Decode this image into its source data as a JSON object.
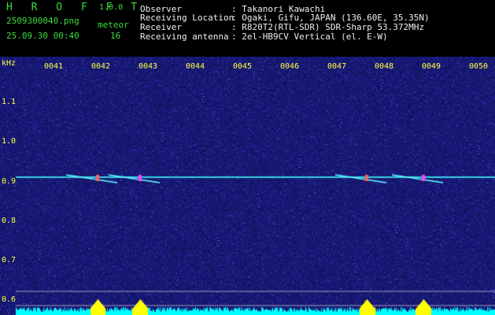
{
  "app": {
    "name": "H R O F F T",
    "version": "1.0.0"
  },
  "file": {
    "name": "2509300040.png",
    "datetime": "25.09.30 00:40"
  },
  "meteor": {
    "label": "meteor",
    "count": "16"
  },
  "info": {
    "observer_label": "Observer",
    "observer_value": ": Takanori Kawachi",
    "location_label": "Receiving Location",
    "location_value": ": Ogaki, Gifu, JAPAN (136.60E, 35.35N)",
    "receiver_label": "Receiver",
    "receiver_value": ": R820T2(RTL-SDR) SDR-Sharp 53.372MHz",
    "antenna_label": "Receiving antenna",
    "antenna_value": ": 2el-HB9CV Vertical (el. E-W)"
  },
  "axis": {
    "y_unit": "kHz",
    "y_ticks": [
      "1.1",
      "1.0",
      "0.9",
      "0.8",
      "0.7",
      "0.6"
    ],
    "x_ticks": [
      "0041",
      "0042",
      "0043",
      "0044",
      "0045",
      "0046",
      "0047",
      "0048",
      "0049",
      "0050"
    ]
  },
  "spectrogram": {
    "carrier_khz": 0.908,
    "freq_range_khz": [
      0.6,
      1.15
    ],
    "time_range_min": [
      40.6,
      50.0
    ],
    "meteor_echoes_min": [
      42.0,
      42.9,
      47.7,
      48.9
    ],
    "colors": {
      "background": "#1a1a70",
      "carrier": "#40ffff",
      "bars": "#00ffff",
      "peaks": "#ffff00"
    }
  }
}
